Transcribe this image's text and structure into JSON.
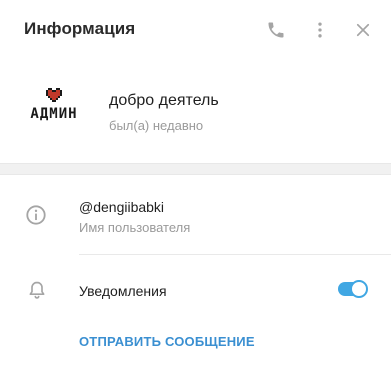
{
  "header": {
    "title": "Информация",
    "icons": [
      "phone-icon",
      "more-vertical-icon",
      "close-icon"
    ]
  },
  "profile": {
    "name": "добро деятель",
    "status": "был(а) недавно",
    "avatar_text": "АДМИН",
    "avatar_icon": "heart-icon"
  },
  "user_info": {
    "username": "@dengiibabki",
    "username_label": "Имя пользователя",
    "icon": "info-icon"
  },
  "notifications": {
    "label": "Уведомления",
    "enabled": true,
    "icon": "bell-icon"
  },
  "actions": {
    "send_message": "ОТПРАВИТЬ СООБЩЕНИЕ"
  },
  "colors": {
    "accent": "#40a7e3",
    "link": "#3a8fd1",
    "secondary_text": "#9a9a9a",
    "icon_gray": "#a5a5a5",
    "heart": "#c0392b"
  }
}
